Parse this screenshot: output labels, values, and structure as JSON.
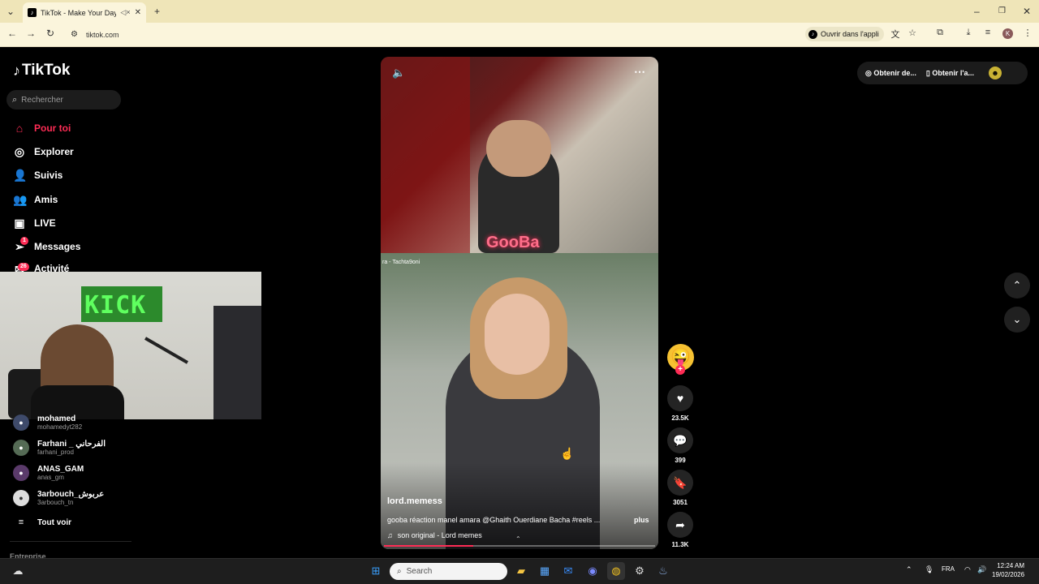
{
  "browser": {
    "tab_title": "TikTok - Make Your Day",
    "tab_favicon": "tiktok-icon",
    "url": "tiktok.com",
    "open_in_app_label": "Ouvrir dans l'appli",
    "profile_initial": "K"
  },
  "sidebar": {
    "logo": "TikTok",
    "search_placeholder": "Rechercher",
    "nav": [
      {
        "label": "Pour toi",
        "icon": "home-icon",
        "active": true
      },
      {
        "label": "Explorer",
        "icon": "compass-icon"
      },
      {
        "label": "Suivis",
        "icon": "following-icon"
      },
      {
        "label": "Amis",
        "icon": "friends-icon"
      },
      {
        "label": "LIVE",
        "icon": "live-icon"
      },
      {
        "label": "Messages",
        "icon": "send-icon",
        "badge": "1"
      },
      {
        "label": "Activité",
        "icon": "inbox-icon",
        "badge": "26"
      }
    ],
    "following_accounts": [
      {
        "name": "mohamed",
        "handle": "mohamedyt282"
      },
      {
        "name": "Farhani _ الفرحاني",
        "handle": "farhani_prod"
      },
      {
        "name": "ANAS_GAM",
        "handle": "anas_gm"
      },
      {
        "name": "3arbouch_عربوش",
        "handle": "3arbouch_tn"
      }
    ],
    "see_all": "Tout voir",
    "footer_label": "Entreprise"
  },
  "video": {
    "overlay_text_top": "GooBa",
    "overlay_text_bottom": "ra - Tachta9oni",
    "author": "lord.memess",
    "caption": "gooba réaction manel amara @Ghaith Ouerdiane Bacha #reels ...",
    "more_label": "plus",
    "sound": "son original - Lord memes",
    "progress": 0.33
  },
  "actions": {
    "likes": "23.5K",
    "comments": "399",
    "saves": "3051",
    "shares": "11.3K"
  },
  "top_right": {
    "get_coins_label": "Obtenir de...",
    "get_app_label": "Obtenir l'a..."
  },
  "taskbar": {
    "search_placeholder": "Search",
    "language": "FRA",
    "time": "12:24 AM",
    "date": "19/02/2026"
  }
}
